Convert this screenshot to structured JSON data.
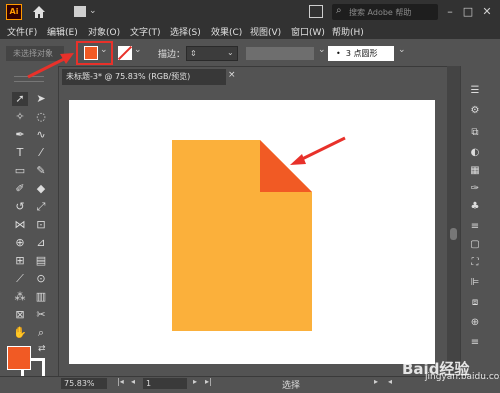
{
  "app": {
    "logo": "Ai",
    "search_placeholder": "搜索 Adobe 帮助"
  },
  "menu": [
    "文件(F)",
    "编辑(E)",
    "对象(O)",
    "文字(T)",
    "选择(S)",
    "效果(C)",
    "视图(V)",
    "窗口(W)",
    "帮助(H)"
  ],
  "controlbar": {
    "selection_status": "未选择对象",
    "fill_color": "#f15a24",
    "stroke_label": "描边：",
    "brush_label": "3 点圆形"
  },
  "document": {
    "tab_title": "未标题-3* @ 75.83% (RGB/预览)",
    "close_glyph": "×",
    "shape_color": "#fbb03b",
    "fold_color": "#f15a24"
  },
  "status": {
    "zoom": "75.83%",
    "page": "1",
    "tool_text": "选择"
  },
  "watermark": {
    "logo": "Baid经验",
    "url": "jingyan.baidu.com"
  },
  "colors": {
    "annotation_red": "#e8312a"
  }
}
